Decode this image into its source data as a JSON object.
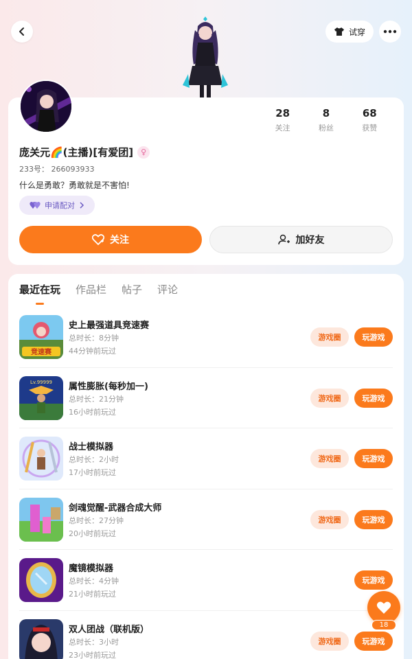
{
  "header": {
    "try_on_label": "试穿"
  },
  "profile": {
    "username": "庞关元🌈(主播)[有爱团]",
    "uid_label": "233号：",
    "uid": "266093933",
    "bio": "什么是勇敢？勇敢就是不害怕!",
    "pair_label": "申请配对",
    "stats": [
      {
        "value": "28",
        "label": "关注"
      },
      {
        "value": "8",
        "label": "粉丝"
      },
      {
        "value": "68",
        "label": "获赞"
      }
    ],
    "follow_label": "关注",
    "add_friend_label": "加好友"
  },
  "tabs": [
    {
      "label": "最近在玩",
      "active": true
    },
    {
      "label": "作品栏",
      "active": false
    },
    {
      "label": "帖子",
      "active": false
    },
    {
      "label": "评论",
      "active": false
    }
  ],
  "games": [
    {
      "title": "史上最强道具竞速赛",
      "duration": "总时长：8分钟",
      "played": "44分钟前玩过",
      "circle": "游戏圈",
      "play": "玩游戏",
      "icon_text": "竞速赛"
    },
    {
      "title": "属性膨胀(每秒加一)",
      "duration": "总时长：21分钟",
      "played": "16小时前玩过",
      "circle": "游戏圈",
      "play": "玩游戏",
      "icon_text": "Lv.99999"
    },
    {
      "title": "战士模拟器",
      "duration": "总时长：2小时",
      "played": "17小时前玩过",
      "circle": "游戏圈",
      "play": "玩游戏",
      "icon_text": ""
    },
    {
      "title": "剑魂觉醒-武器合成大师",
      "duration": "总时长：27分钟",
      "played": "20小时前玩过",
      "circle": "游戏圈",
      "play": "玩游戏",
      "icon_text": ""
    },
    {
      "title": "魔镜模拟器",
      "duration": "总时长：4分钟",
      "played": "21小时前玩过",
      "circle": "",
      "play": "玩游戏",
      "icon_text": ""
    },
    {
      "title": "双人团战（联机版）",
      "duration": "总时长：3小时",
      "played": "23小时前玩过",
      "circle": "游戏圈",
      "play": "玩游戏",
      "icon_text": ""
    }
  ],
  "fab": {
    "count": "18"
  },
  "colors": {
    "accent": "#fb7a1c",
    "accent_light": "#fde7dc",
    "pair_bg": "#efeaf9",
    "pair_text": "#6a5ac2"
  }
}
